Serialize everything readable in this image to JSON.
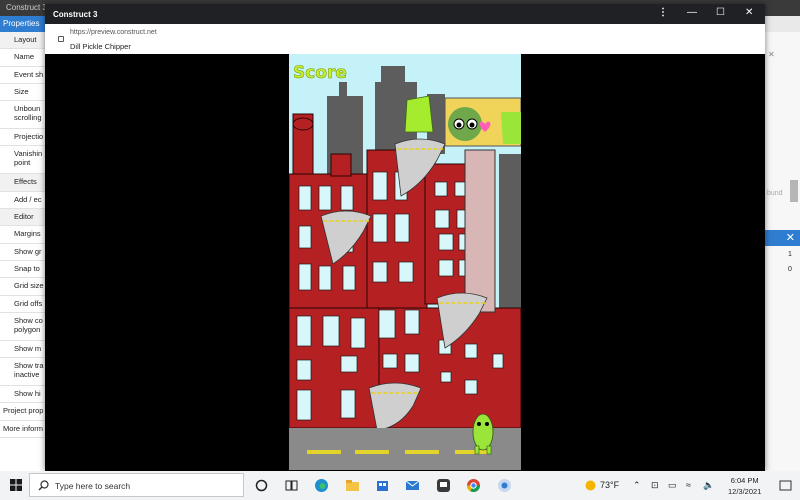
{
  "background_app": {
    "title": "Construct 3",
    "properties_header": "Properties",
    "property_rows": [
      {
        "label": "Layout",
        "type": "section"
      },
      {
        "label": "Name",
        "type": "row"
      },
      {
        "label": "Event sh",
        "type": "row"
      },
      {
        "label": "Size",
        "type": "row"
      },
      {
        "label": "Unboun scrolling",
        "type": "two"
      },
      {
        "label": "Projectio",
        "type": "row"
      },
      {
        "label": "Vanishin point",
        "type": "two"
      },
      {
        "label": "Effects",
        "type": "section"
      },
      {
        "label": "Add / ec",
        "type": "row"
      },
      {
        "label": "Editor",
        "type": "section"
      },
      {
        "label": "Margins",
        "type": "row"
      },
      {
        "label": "Show gr",
        "type": "row"
      },
      {
        "label": "Snap to",
        "type": "row"
      },
      {
        "label": "Grid size",
        "type": "row"
      },
      {
        "label": "Grid offs",
        "type": "row"
      },
      {
        "label": "Show co polygon",
        "type": "two"
      },
      {
        "label": "Show m",
        "type": "row"
      },
      {
        "label": "Show tra inactive",
        "type": "two"
      },
      {
        "label": "Show hi",
        "type": "row"
      },
      {
        "label": "Project prop",
        "type": "flat"
      },
      {
        "label": "More inform",
        "type": "flat"
      }
    ],
    "right_panel": {
      "ghost_text": "bund",
      "value1": "1",
      "value2": "0"
    }
  },
  "browser": {
    "window_title": "Construct 3",
    "url": "https://preview.construct.net",
    "page_title": "Dill Pickle Chipper"
  },
  "game": {
    "score_label": "Score"
  },
  "taskbar": {
    "search_placeholder": "Type here to search",
    "weather": "73°F",
    "time": "6:04 PM",
    "date": "12/3/2021"
  },
  "colors": {
    "accent": "#2f7dd1",
    "building_red": "#b52022",
    "sky": "#c4f2f8",
    "pickle_green": "#9be43a"
  }
}
